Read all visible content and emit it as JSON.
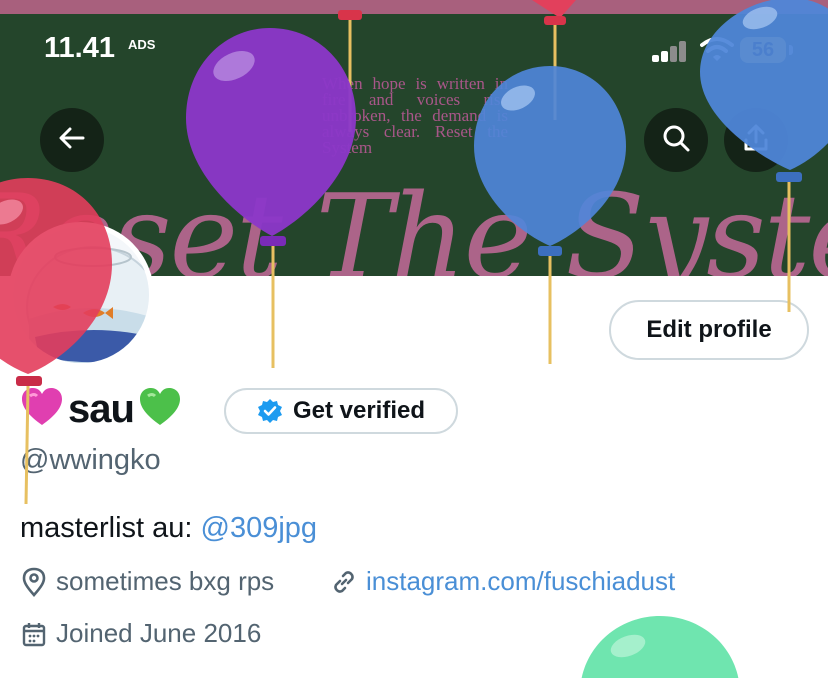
{
  "status_bar": {
    "time": "11.41",
    "carrier_badge": "ADS",
    "battery": "56",
    "icons": [
      "signal-icon",
      "wifi-icon",
      "battery-icon"
    ]
  },
  "banner": {
    "poem": "When hope is written in fire and voices rise unbroken, the demand is always clear. Reset the System",
    "script_text": "Reset The System"
  },
  "header_buttons": {
    "back": "back-arrow-icon",
    "search": "search-icon",
    "share": "share-icon"
  },
  "profile": {
    "display_name": "sau",
    "name_emoji_left": "pink-heart",
    "name_emoji_right": "green-heart",
    "handle": "@wwingko",
    "edit_button": "Edit profile",
    "verify_button": "Get verified",
    "bio_prefix": "masterlist au:",
    "bio_mention": "@309jpg",
    "location": "sometimes bxg rps",
    "website": "instagram.com/fuschiadust",
    "joined": "Joined June 2016"
  },
  "colors": {
    "link": "#4a8fd6",
    "banner": "#24452b",
    "verified": "#1d9bf0",
    "muted": "#536471"
  }
}
